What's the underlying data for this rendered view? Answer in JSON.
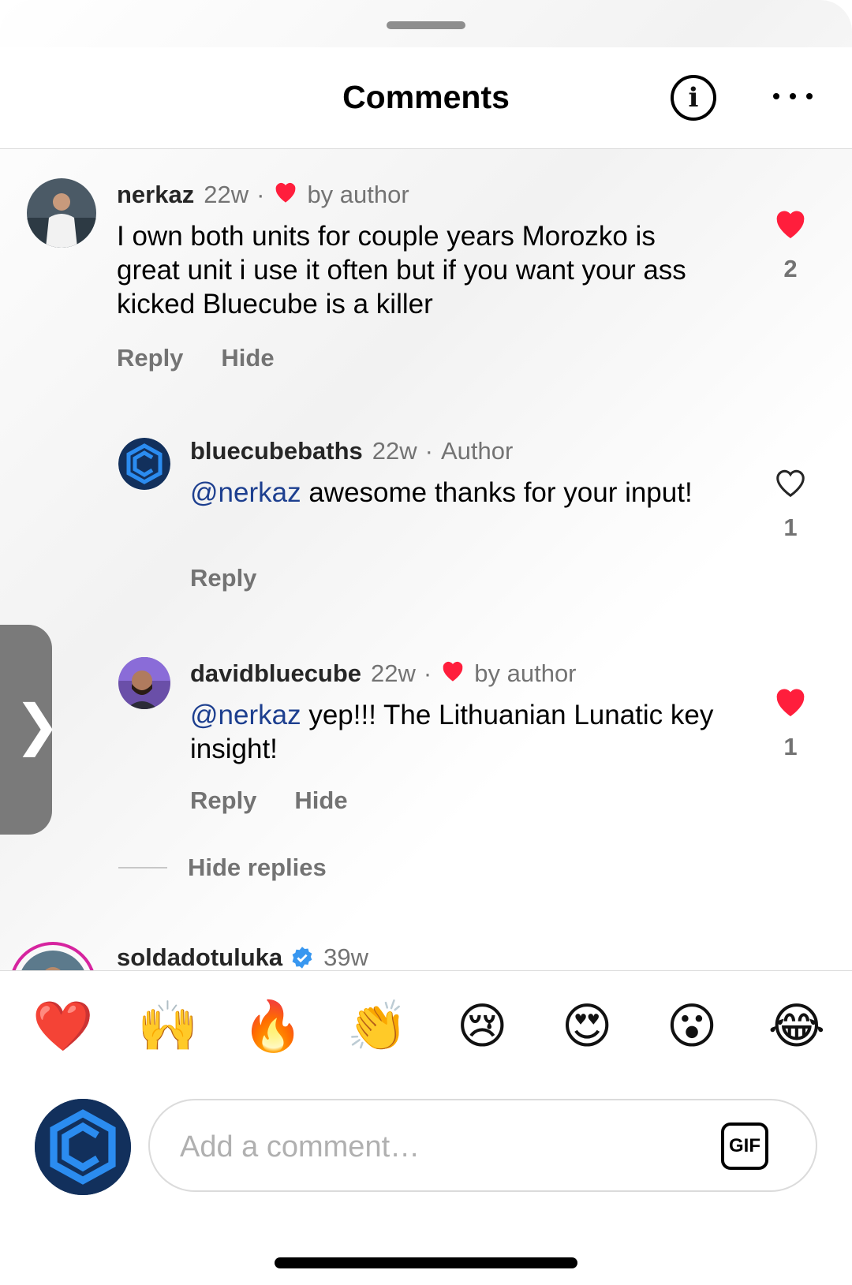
{
  "header": {
    "title": "Comments"
  },
  "comments": [
    {
      "user": "nerkaz",
      "time": "22w",
      "tag": "by author",
      "liked_by_author": true,
      "text": "I own both units for couple years Morozko is great unit i use it often but if you want your ass kicked  Bluecube is a killer",
      "actions": [
        "Reply",
        "Hide"
      ],
      "likes": "2",
      "liked": true
    },
    {
      "user": "bluecubebaths",
      "time": "22w",
      "tag": "Author",
      "mention": "@nerkaz",
      "text": "awesome thanks for your input!",
      "actions": [
        "Reply"
      ],
      "likes": "1",
      "liked": false
    },
    {
      "user": "davidbluecube",
      "time": "22w",
      "tag": "by author",
      "liked_by_author": true,
      "mention": "@nerkaz",
      "text": "yep!!! The Lithuanian Lunatic key insight!",
      "actions": [
        "Reply",
        "Hide"
      ],
      "likes": "1",
      "liked": true
    },
    {
      "user": "soldadotuluka",
      "time": "39w",
      "verified": true
    }
  ],
  "hide_replies_label": "Hide replies",
  "side_tab_icon": "chevron-right-icon",
  "reactions": [
    "❤️",
    "🙌",
    "🔥",
    "👏",
    "😢",
    "😍",
    "😮",
    "😂"
  ],
  "composer": {
    "placeholder": "Add a comment…",
    "gif_label": "GIF"
  },
  "colors": {
    "like_red": "#ff1e3c",
    "mention": "#1d3f8f",
    "brand": "#1a7ad9"
  }
}
